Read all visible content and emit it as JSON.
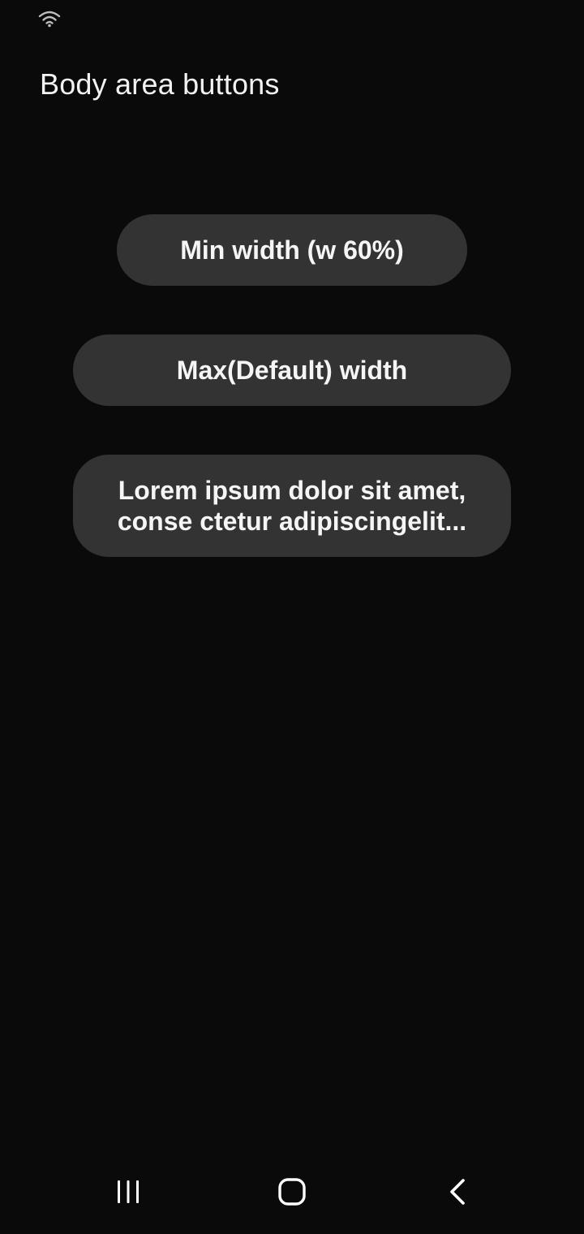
{
  "status_bar": {
    "wifi_icon": "wifi-icon"
  },
  "header": {
    "title": "Body area buttons"
  },
  "buttons": {
    "min_width": "Min width (w 60%)",
    "max_width": "Max(Default) width",
    "lorem": "Lorem ipsum dolor sit amet, conse ctetur adipiscingelit..."
  },
  "nav_bar": {
    "recents_icon": "recents-icon",
    "home_icon": "home-icon",
    "back_icon": "back-icon"
  },
  "colors": {
    "background": "#0a0a0a",
    "button_background": "#333333",
    "text": "#ffffff"
  }
}
